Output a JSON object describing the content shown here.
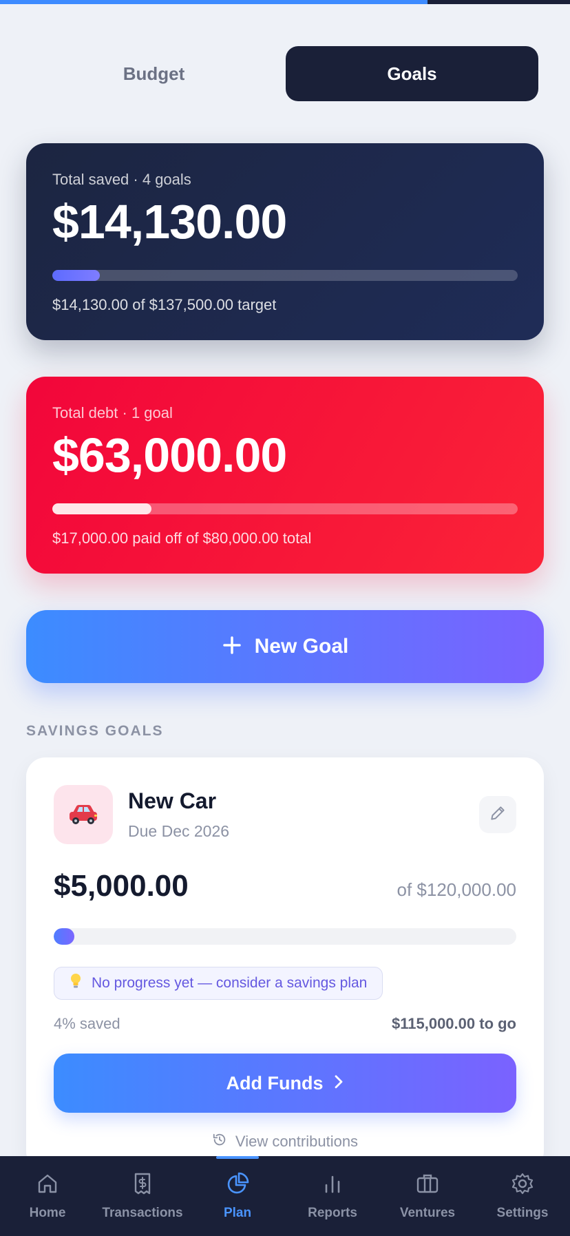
{
  "top_progress": {
    "fraction": 0.75
  },
  "tabs": [
    {
      "label": "Budget",
      "active": false
    },
    {
      "label": "Goals",
      "active": true
    }
  ],
  "saved_summary": {
    "label": "Total saved · 4 goals",
    "amount": "$14,130.00",
    "progress": 0.1028,
    "caption": "$14,130.00 of $137,500.00 target"
  },
  "debt_summary": {
    "label": "Total debt · 1 goal",
    "amount": "$63,000.00",
    "progress": 0.2125,
    "caption": "$17,000.00 paid off of $80,000.00 total"
  },
  "new_goal": {
    "icon": "plus-icon",
    "label": "New Goal"
  },
  "section_title": "SAVINGS GOALS",
  "goal": {
    "icon": "car-icon",
    "name": "New Car",
    "due": "Due Dec 2026",
    "current": "$5,000.00",
    "target": "of $120,000.00",
    "progress": 0.04,
    "tip": "No progress yet — consider a savings plan",
    "pct": "4% saved",
    "to_go": "$115,000.00 to go",
    "add_funds": "Add Funds",
    "view_contrib": "View contributions"
  },
  "nav": [
    {
      "label": "Home",
      "icon": "home-icon"
    },
    {
      "label": "Transactions",
      "icon": "receipt-icon"
    },
    {
      "label": "Plan",
      "icon": "pie-chart-icon",
      "active": true
    },
    {
      "label": "Reports",
      "icon": "bar-chart-icon"
    },
    {
      "label": "Ventures",
      "icon": "briefcase-icon"
    },
    {
      "label": "Settings",
      "icon": "gear-icon"
    }
  ],
  "colors": {
    "navy": "#1a2038",
    "accent_blue": "#3c8cff",
    "accent_purple": "#7a62ff",
    "debt_red": "#f2063a"
  }
}
